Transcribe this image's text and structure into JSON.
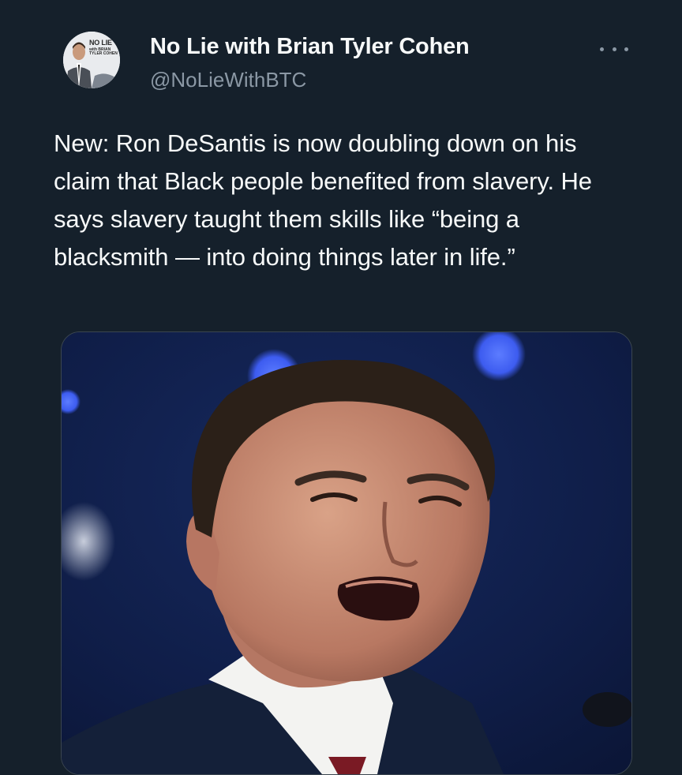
{
  "author": {
    "display_name": "No Lie with Brian Tyler Cohen",
    "handle": "@NoLieWithBTC",
    "avatar_logo_text": "NO LIE",
    "avatar_logo_subtext": "with BRIAN TYLER COHEN"
  },
  "tweet": {
    "text": "New: Ron DeSantis is now doubling down on his claim that Black people benefited from slavery. He says slavery taught them skills like “being a blacksmith — into doing things later in life.”"
  },
  "media": {
    "type": "photo"
  },
  "icons": {
    "more": "more-horizontal-icon"
  },
  "colors": {
    "background": "#15202b",
    "primary_text": "#f7f9f9",
    "secondary_text": "#8b98a5",
    "border": "#3b4650"
  }
}
